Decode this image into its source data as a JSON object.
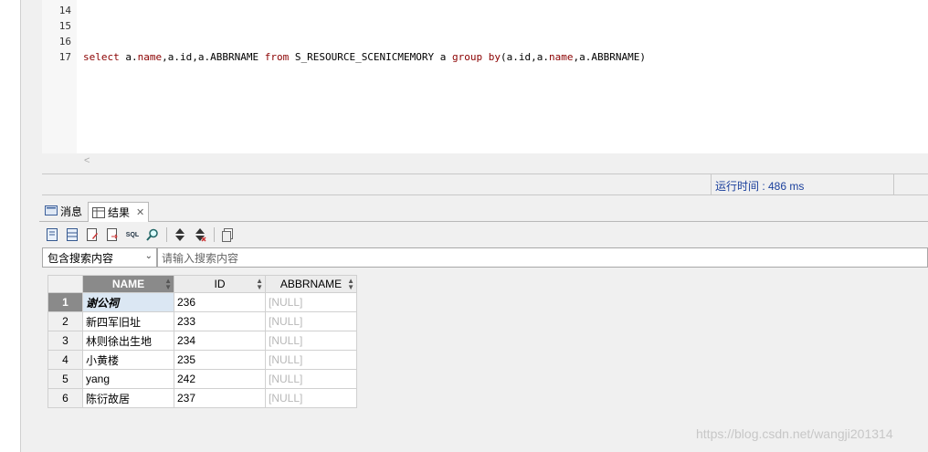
{
  "editor": {
    "line_numbers": [
      "14",
      "15",
      "16",
      "17"
    ],
    "sql": {
      "t1": "select",
      "t2": " a.",
      "t3": "name",
      "t4": ",a.id,a.ABBRNAME ",
      "t5": "from",
      "t6": " S_RESOURCE_SCENICMEMORY a ",
      "t7": "group",
      "t8": " ",
      "t9": "by",
      "t10": "(a.id,a.",
      "t11": "name",
      "t12": ",a.ABBRNAME)"
    },
    "scroll_left_arrow": "<"
  },
  "status": {
    "runtime": "运行时间 : 486 ms"
  },
  "tabs": [
    {
      "label": "消息",
      "icon": "message-icon"
    },
    {
      "label": "结果",
      "icon": "result-grid-icon",
      "close": "✕"
    }
  ],
  "toolbar": {
    "sql_label": "SQL",
    "icons": [
      "document-icon",
      "grid-view-icon",
      "edit-doc-icon",
      "export-doc-icon",
      "sql-icon",
      "search-icon",
      "sort-asc-icon",
      "sort-desc-icon",
      "copy-icon"
    ]
  },
  "search": {
    "mode": "包含搜索内容",
    "placeholder": "请输入搜索内容"
  },
  "grid": {
    "columns": [
      "NAME",
      "ID",
      "ABBRNAME"
    ],
    "rows": [
      {
        "n": "1",
        "name": "谢公祠",
        "id": "236",
        "abbr": "[NULL]"
      },
      {
        "n": "2",
        "name": "新四军旧址",
        "id": "233",
        "abbr": "[NULL]"
      },
      {
        "n": "3",
        "name": "林则徐出生地",
        "id": "234",
        "abbr": "[NULL]"
      },
      {
        "n": "4",
        "name": "小黄楼",
        "id": "235",
        "abbr": "[NULL]"
      },
      {
        "n": "5",
        "name": "yang",
        "id": "242",
        "abbr": "[NULL]"
      },
      {
        "n": "6",
        "name": "陈衍故居",
        "id": "237",
        "abbr": "[NULL]"
      }
    ]
  },
  "watermark": "https://blog.csdn.net/wangji201314"
}
